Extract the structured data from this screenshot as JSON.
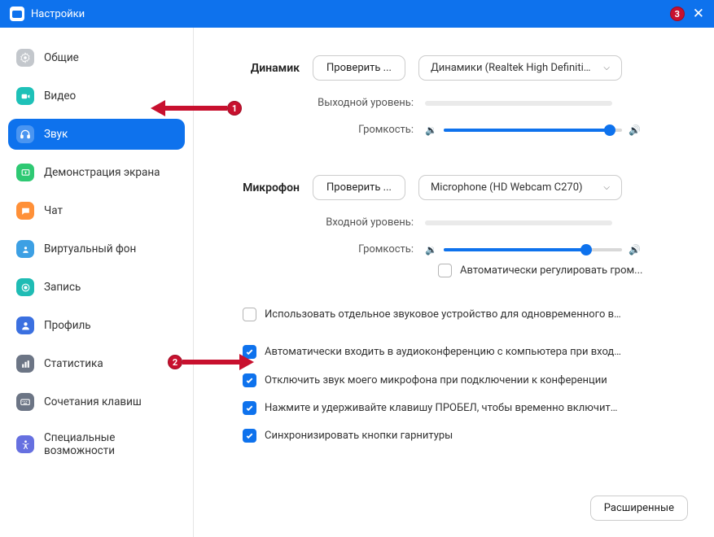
{
  "titlebar": {
    "title": "Настройки",
    "annotation_badge": "3"
  },
  "sidebar": {
    "items": [
      {
        "label": "Общие",
        "icon": "general",
        "color": "#c3c7cc"
      },
      {
        "label": "Видео",
        "icon": "video",
        "color": "#1ec1b8"
      },
      {
        "label": "Звук",
        "icon": "headphones",
        "color": "#ffffff",
        "selected": true
      },
      {
        "label": "Демонстрация экрана",
        "icon": "screen-share",
        "color": "#2ec973"
      },
      {
        "label": "Чат",
        "icon": "chat",
        "color": "#ff9038"
      },
      {
        "label": "Виртуальный фон",
        "icon": "virtual-bg",
        "color": "#3da0e4"
      },
      {
        "label": "Запись",
        "icon": "record",
        "color": "#1fbcb4"
      },
      {
        "label": "Профиль",
        "icon": "profile",
        "color": "#3b70e0"
      },
      {
        "label": "Статистика",
        "icon": "stats",
        "color": "#6c7585"
      },
      {
        "label": "Сочетания клавиш",
        "icon": "keyboard",
        "color": "#6c7585"
      },
      {
        "label": "Специальные возможности",
        "icon": "accessibility",
        "color": "#6670e0"
      }
    ]
  },
  "main": {
    "speaker": {
      "label": "Динамик",
      "test_button": "Проверить ...",
      "device": "Динамики (Realtek High Definitio...",
      "output_level_label": "Выходной уровень:",
      "volume_label": "Громкость:",
      "volume_value": 93
    },
    "microphone": {
      "label": "Микрофон",
      "test_button": "Проверить ...",
      "device": "Microphone (HD Webcam C270)",
      "input_level_label": "Входной уровень:",
      "volume_label": "Громкость:",
      "volume_value": 80,
      "auto_adjust_label": "Автоматически регулировать гром..."
    },
    "checkboxes": [
      {
        "checked": false,
        "label": "Использовать отдельное звуковое устройство для одновременного воспро..."
      },
      {
        "checked": true,
        "label": "Автоматически входить в аудиоконференцию с компьютера при входе в кон..."
      },
      {
        "checked": true,
        "label": "Отключить звук моего микрофона при подключении к конференции"
      },
      {
        "checked": true,
        "label": "Нажмите и удерживайте клавишу ПРОБЕЛ, чтобы временно включить свой з..."
      },
      {
        "checked": true,
        "label": "Синхронизировать кнопки гарнитуры"
      }
    ],
    "advanced_button": "Расширенные"
  },
  "annotations": {
    "badge1": "1",
    "badge2": "2"
  }
}
